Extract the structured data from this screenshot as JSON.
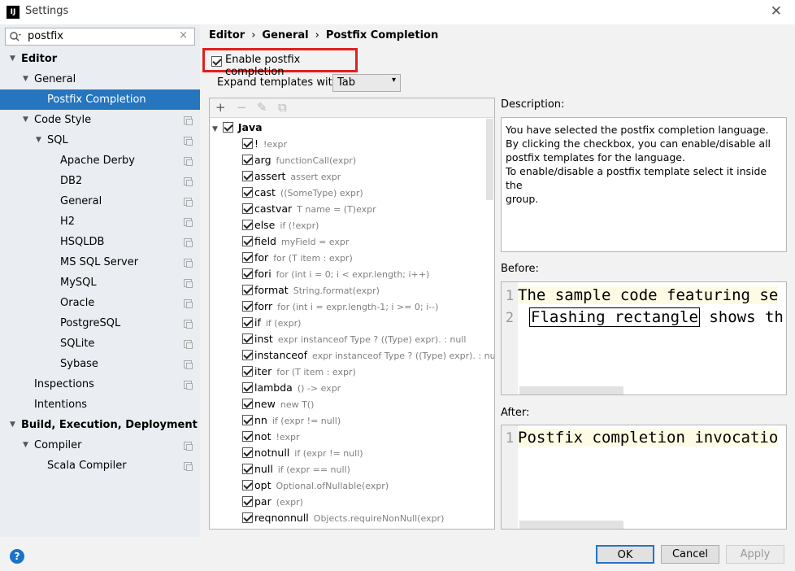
{
  "window": {
    "title": "Settings",
    "logo": "IJ"
  },
  "search": {
    "value": "postfix",
    "clear": "×"
  },
  "tree": [
    {
      "label": "Editor",
      "depth": 0,
      "bold": true,
      "arrow": "▼"
    },
    {
      "label": "General",
      "depth": 1,
      "arrow": "▼"
    },
    {
      "label": "Postfix Completion",
      "depth": 2,
      "selected": true
    },
    {
      "label": "Code Style",
      "depth": 1,
      "arrow": "▼",
      "copy": true
    },
    {
      "label": "SQL",
      "depth": 2,
      "arrow": "▼",
      "copy": true
    },
    {
      "label": "Apache Derby",
      "depth": 3,
      "copy": true
    },
    {
      "label": "DB2",
      "depth": 3,
      "copy": true
    },
    {
      "label": "General",
      "depth": 3,
      "copy": true
    },
    {
      "label": "H2",
      "depth": 3,
      "copy": true
    },
    {
      "label": "HSQLDB",
      "depth": 3,
      "copy": true
    },
    {
      "label": "MS SQL Server",
      "depth": 3,
      "copy": true
    },
    {
      "label": "MySQL",
      "depth": 3,
      "copy": true
    },
    {
      "label": "Oracle",
      "depth": 3,
      "copy": true
    },
    {
      "label": "PostgreSQL",
      "depth": 3,
      "copy": true
    },
    {
      "label": "SQLite",
      "depth": 3,
      "copy": true
    },
    {
      "label": "Sybase",
      "depth": 3,
      "copy": true
    },
    {
      "label": "Inspections",
      "depth": 1,
      "copy": true
    },
    {
      "label": "Intentions",
      "depth": 1
    },
    {
      "label": "Build, Execution, Deployment",
      "depth": 0,
      "bold": true,
      "arrow": "▼"
    },
    {
      "label": "Compiler",
      "depth": 1,
      "arrow": "▼",
      "copy": true
    },
    {
      "label": "Scala Compiler",
      "depth": 2,
      "copy": true
    }
  ],
  "breadcrumb": [
    "Editor",
    "General",
    "Postfix Completion"
  ],
  "breadcrumb_sep": "›",
  "enable": {
    "label": "Enable postfix completion",
    "checked": true
  },
  "expand": {
    "label": "Expand templates with",
    "value": "Tab",
    "chevron": "▾"
  },
  "toolbar": {
    "add": "+",
    "remove": "−",
    "edit": "✎",
    "copy": "⧉"
  },
  "group": {
    "arrow": "▼",
    "name": "Java"
  },
  "templates": [
    {
      "key": "!",
      "desc": "!expr"
    },
    {
      "key": "arg",
      "desc": "functionCall(expr)"
    },
    {
      "key": "assert",
      "desc": "assert expr"
    },
    {
      "key": "cast",
      "desc": "((SomeType) expr)"
    },
    {
      "key": "castvar",
      "desc": "T name = (T)expr"
    },
    {
      "key": "else",
      "desc": "if (!expr)"
    },
    {
      "key": "field",
      "desc": "myField = expr"
    },
    {
      "key": "for",
      "desc": "for (T item : expr)"
    },
    {
      "key": "fori",
      "desc": "for (int i = 0; i < expr.length; i++)"
    },
    {
      "key": "format",
      "desc": "String.format(expr)"
    },
    {
      "key": "forr",
      "desc": "for (int i = expr.length-1; i >= 0; i--)"
    },
    {
      "key": "if",
      "desc": "if (expr)"
    },
    {
      "key": "inst",
      "desc": "expr instanceof Type ? ((Type) expr). : null"
    },
    {
      "key": "instanceof",
      "desc": "expr instanceof Type ? ((Type) expr). : nul"
    },
    {
      "key": "iter",
      "desc": "for (T item : expr)"
    },
    {
      "key": "lambda",
      "desc": "() -> expr"
    },
    {
      "key": "new",
      "desc": "new T()"
    },
    {
      "key": "nn",
      "desc": "if (expr != null)"
    },
    {
      "key": "not",
      "desc": "!expr"
    },
    {
      "key": "notnull",
      "desc": "if (expr != null)"
    },
    {
      "key": "null",
      "desc": "if (expr == null)"
    },
    {
      "key": "opt",
      "desc": "Optional.ofNullable(expr)"
    },
    {
      "key": "par",
      "desc": "(expr)"
    },
    {
      "key": "reqnonnull",
      "desc": "Objects.requireNonNull(expr)"
    }
  ],
  "description": {
    "label": "Description:",
    "lines": [
      "You have selected the postfix completion language.",
      "By clicking the checkbox, you can enable/disable all",
      "postfix templates for the language.",
      "To enable/disable a postfix template select it inside the",
      "group."
    ]
  },
  "before": {
    "label": "Before:",
    "line1_num": "1",
    "line1": "The sample code featuring se",
    "line2_num": "2",
    "line2_flash": "Flashing rectangle",
    "line2_rest": " shows th"
  },
  "after": {
    "label": "After:",
    "line1_num": "1",
    "line1": "Postfix completion invocatio"
  },
  "buttons": {
    "help": "?",
    "ok": "OK",
    "cancel": "Cancel",
    "apply": "Apply"
  }
}
